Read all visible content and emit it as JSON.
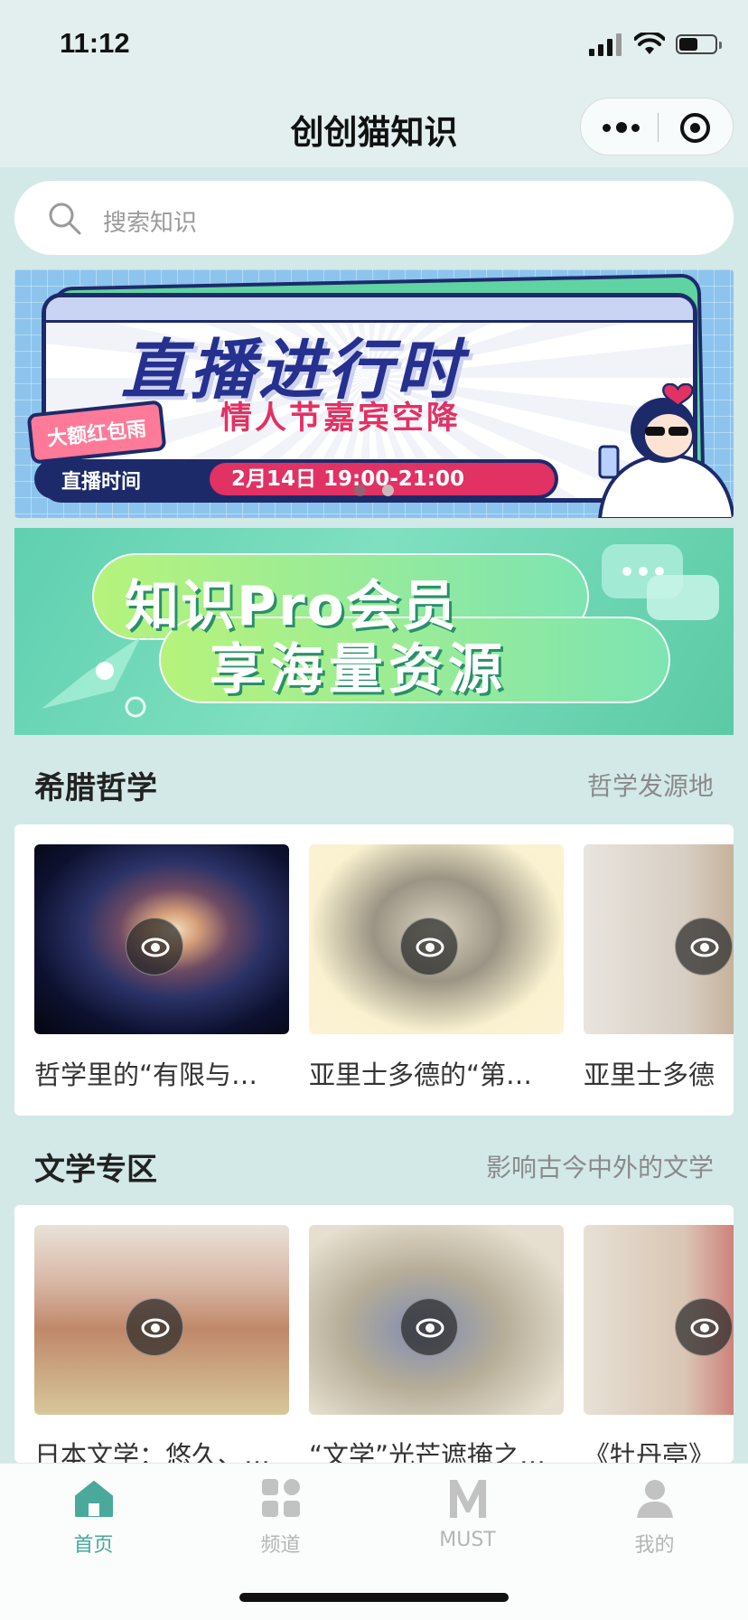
{
  "status": {
    "time": "11:12"
  },
  "header": {
    "title": "创创猫知识"
  },
  "search": {
    "placeholder": "搜索知识"
  },
  "banner": {
    "title": "直播进行时",
    "subtitle": "情人节嘉宾空降",
    "tag": "大额红包雨",
    "time_label": "直播时间",
    "time_value": "2月14日 19:00-21:00",
    "slide_index": 2,
    "slide_count": 2
  },
  "promo": {
    "line1": "知识Pro会员",
    "line2": "享海量资源"
  },
  "sections": [
    {
      "title": "希腊哲学",
      "subtitle": "哲学发源地",
      "items": [
        {
          "title": "哲学里的“有限与…"
        },
        {
          "title": "亚里士多德的“第…"
        },
        {
          "title": "亚里士多德"
        }
      ]
    },
    {
      "title": "文学专区",
      "subtitle": "影响古今中外的文学",
      "items": [
        {
          "title": "日本文学：悠久、…"
        },
        {
          "title": "“文学”光芒遮掩之…"
        },
        {
          "title": "《牡丹亭》"
        }
      ]
    }
  ],
  "tabbar": {
    "items": [
      {
        "label": "首页",
        "icon": "home-icon",
        "active": true
      },
      {
        "label": "频道",
        "icon": "grid-icon",
        "active": false
      },
      {
        "label": "MUST",
        "icon": "m-icon",
        "active": false
      },
      {
        "label": "我的",
        "icon": "user-icon",
        "active": false
      }
    ]
  },
  "colors": {
    "accent": "#4aa99a",
    "background": "#d3e9e7",
    "banner_navy": "#1d2a6a",
    "banner_pink": "#e23163"
  }
}
